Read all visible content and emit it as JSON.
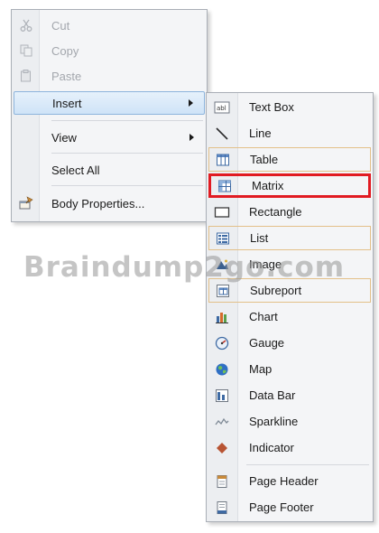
{
  "context_menu": {
    "items": [
      {
        "label": "Cut",
        "icon": "scissors-icon",
        "disabled": true
      },
      {
        "label": "Copy",
        "icon": "copy-icon",
        "disabled": true
      },
      {
        "label": "Paste",
        "icon": "paste-icon",
        "disabled": true
      },
      {
        "label": "Insert",
        "has_submenu": true,
        "highlighted": true
      },
      {
        "label": "View",
        "has_submenu": true
      },
      {
        "label": "Select All"
      },
      {
        "label": "Body Properties...",
        "icon": "body-properties-icon"
      }
    ]
  },
  "insert_submenu": {
    "items": [
      {
        "label": "Text Box",
        "icon": "text-box-icon"
      },
      {
        "label": "Line",
        "icon": "line-icon"
      },
      {
        "label": "Table",
        "icon": "table-icon",
        "boxed": true
      },
      {
        "label": "Matrix",
        "icon": "matrix-icon",
        "selected": true
      },
      {
        "label": "Rectangle",
        "icon": "rectangle-icon"
      },
      {
        "label": "List",
        "icon": "list-icon",
        "boxed": true
      },
      {
        "label": "Image",
        "icon": "image-icon"
      },
      {
        "label": "Subreport",
        "icon": "subreport-icon",
        "boxed": true
      },
      {
        "label": "Chart",
        "icon": "chart-icon"
      },
      {
        "label": "Gauge",
        "icon": "gauge-icon"
      },
      {
        "label": "Map",
        "icon": "map-icon"
      },
      {
        "label": "Data Bar",
        "icon": "data-bar-icon"
      },
      {
        "label": "Sparkline",
        "icon": "sparkline-icon"
      },
      {
        "label": "Indicator",
        "icon": "indicator-icon"
      },
      {
        "label": "Page Header",
        "icon": "page-header-icon"
      },
      {
        "label": "Page Footer",
        "icon": "page-footer-icon"
      }
    ]
  },
  "watermark": "Braindump2go.com",
  "colors": {
    "selection_outline": "#e11b22",
    "group_outline": "#e3c089",
    "hover_highlight": "#cfe3f7"
  }
}
